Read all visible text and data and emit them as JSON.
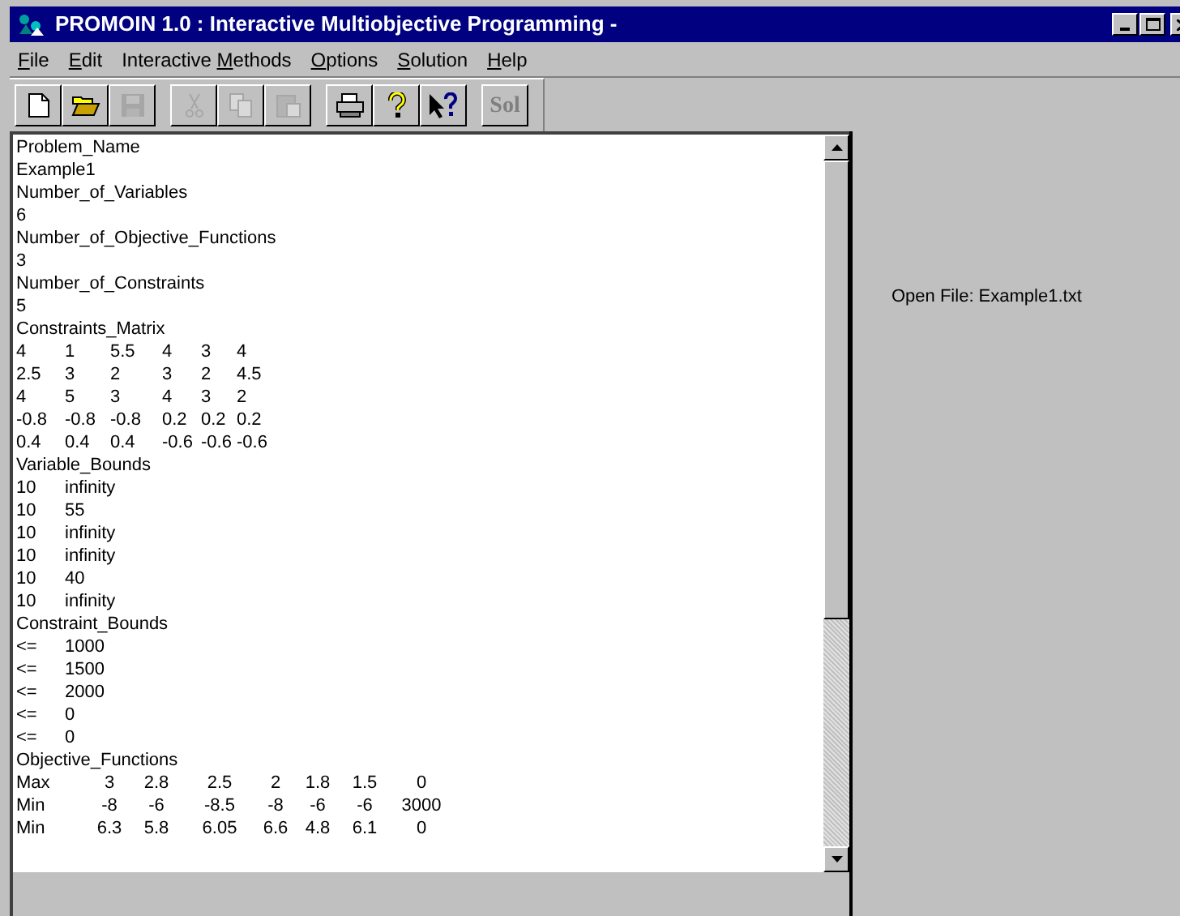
{
  "window": {
    "title": "PROMOIN 1.0 : Interactive Multiobjective Programming -"
  },
  "menu": [
    {
      "key": "F",
      "after": "ile"
    },
    {
      "key": "E",
      "after": "dit"
    },
    {
      "before": "Interactive ",
      "key": "M",
      "after": "ethods"
    },
    {
      "key": "O",
      "after": "ptions"
    },
    {
      "key": "S",
      "after": "olution"
    },
    {
      "key": "H",
      "after": "elp"
    }
  ],
  "toolbar": [
    {
      "buttons": [
        {
          "kind": "new",
          "disabled": false
        },
        {
          "kind": "open",
          "disabled": false
        },
        {
          "kind": "save",
          "disabled": true
        }
      ]
    },
    {
      "buttons": [
        {
          "kind": "cut",
          "disabled": true
        },
        {
          "kind": "copy",
          "disabled": true
        },
        {
          "kind": "paste",
          "disabled": true
        }
      ]
    },
    {
      "buttons": [
        {
          "kind": "print",
          "disabled": false
        },
        {
          "kind": "help",
          "disabled": false
        },
        {
          "kind": "context-help",
          "disabled": false
        }
      ]
    },
    {
      "buttons": [
        {
          "kind": "text",
          "label": "Sol",
          "disabled": true
        }
      ]
    }
  ],
  "editor": {
    "lines": [
      {
        "kind": "plain",
        "cells": [
          "Problem_Name"
        ]
      },
      {
        "kind": "plain",
        "cells": [
          "Example1"
        ]
      },
      {
        "kind": "plain",
        "cells": [
          "Number_of_Variables"
        ]
      },
      {
        "kind": "plain",
        "cells": [
          "6"
        ]
      },
      {
        "kind": "plain",
        "cells": [
          "Number_of_Objective_Functions"
        ]
      },
      {
        "kind": "plain",
        "cells": [
          "3"
        ]
      },
      {
        "kind": "plain",
        "cells": [
          "Number_of_Constraints"
        ]
      },
      {
        "kind": "plain",
        "cells": [
          "5"
        ]
      },
      {
        "kind": "plain",
        "cells": [
          "Constraints_Matrix"
        ]
      },
      {
        "kind": "matrix",
        "cells": [
          "4",
          "1",
          "5.5",
          "4",
          "3",
          "4"
        ]
      },
      {
        "kind": "matrix",
        "cells": [
          "2.5",
          "3",
          "2",
          "3",
          "2",
          "4.5"
        ]
      },
      {
        "kind": "matrix",
        "cells": [
          "4",
          "5",
          "3",
          "4",
          "3",
          "2"
        ]
      },
      {
        "kind": "matrix",
        "cells": [
          "-0.8",
          "-0.8",
          "-0.8",
          "0.2",
          "0.2",
          "0.2"
        ]
      },
      {
        "kind": "matrix",
        "cells": [
          "0.4",
          "0.4",
          "0.4",
          "-0.6",
          "-0.6",
          "-0.6"
        ]
      },
      {
        "kind": "plain",
        "cells": [
          "Variable_Bounds"
        ]
      },
      {
        "kind": "pair",
        "cells": [
          "10",
          "infinity"
        ]
      },
      {
        "kind": "pair",
        "cells": [
          "10",
          "55"
        ]
      },
      {
        "kind": "pair",
        "cells": [
          "10",
          "infinity"
        ]
      },
      {
        "kind": "pair",
        "cells": [
          "10",
          "infinity"
        ]
      },
      {
        "kind": "pair",
        "cells": [
          "10",
          "40"
        ]
      },
      {
        "kind": "pair",
        "cells": [
          "10",
          "infinity"
        ]
      },
      {
        "kind": "plain",
        "cells": [
          "Constraint_Bounds"
        ]
      },
      {
        "kind": "pair",
        "cells": [
          "<=",
          "1000"
        ]
      },
      {
        "kind": "pair",
        "cells": [
          "<=",
          "1500"
        ]
      },
      {
        "kind": "pair",
        "cells": [
          "<=",
          "2000"
        ]
      },
      {
        "kind": "pair",
        "cells": [
          "<=",
          "0"
        ]
      },
      {
        "kind": "pair",
        "cells": [
          "<=",
          "0"
        ]
      },
      {
        "kind": "plain",
        "cells": [
          "Objective_Functions"
        ]
      },
      {
        "kind": "objective",
        "cells": [
          "Max",
          "3",
          "2.8",
          "2.5",
          "2",
          "1.8",
          "1.5",
          "0"
        ]
      },
      {
        "kind": "objective",
        "cells": [
          "Min",
          "-8",
          "-6",
          "-8.5",
          "-8",
          "-6",
          "-6",
          "3000"
        ]
      },
      {
        "kind": "objective",
        "cells": [
          "Min",
          "6.3",
          "5.8",
          "6.05",
          "6.6",
          "4.8",
          "6.1",
          "0"
        ]
      }
    ]
  },
  "status_panel": {
    "text": "Open File: Example1.txt"
  }
}
